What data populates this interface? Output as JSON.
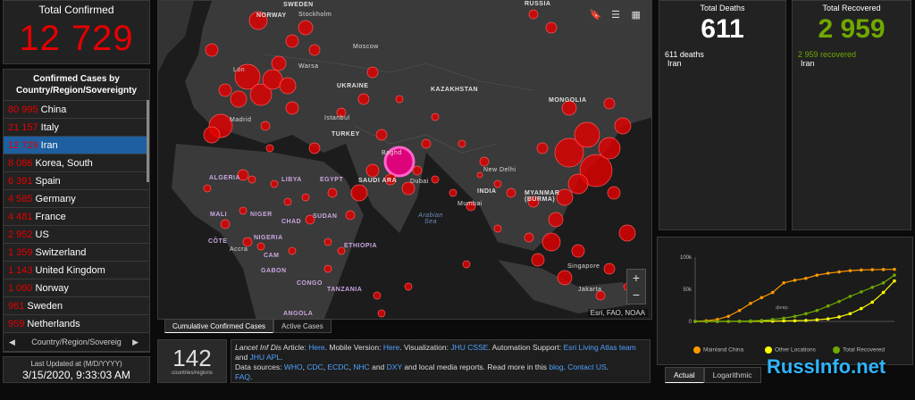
{
  "total_confirmed": {
    "title": "Total Confirmed",
    "value": "12 729"
  },
  "country_list": {
    "title": "Confirmed Cases by Country/Region/Sovereignty",
    "items": [
      {
        "count": "80 995",
        "name": "China"
      },
      {
        "count": "21 157",
        "name": "Italy"
      },
      {
        "count": "12 729",
        "name": "Iran"
      },
      {
        "count": "8 086",
        "name": "Korea, South"
      },
      {
        "count": "6 391",
        "name": "Spain"
      },
      {
        "count": "4 585",
        "name": "Germany"
      },
      {
        "count": "4 481",
        "name": "France"
      },
      {
        "count": "2 952",
        "name": "US"
      },
      {
        "count": "1 359",
        "name": "Switzerland"
      },
      {
        "count": "1 143",
        "name": "United Kingdom"
      },
      {
        "count": "1 090",
        "name": "Norway"
      },
      {
        "count": "961",
        "name": "Sweden"
      },
      {
        "count": "959",
        "name": "Netherlands"
      }
    ],
    "selected_index": 2,
    "tab_label": "Country/Region/Sovereig",
    "prev_arrow": "◀",
    "next_arrow": "▶"
  },
  "last_updated": {
    "label": "Last Updated at (M/D/YYYY)",
    "value": "3/15/2020, 9:33:03 AM"
  },
  "map": {
    "labels": {
      "russia": "RUSSIA",
      "norway": "NORWAY",
      "sweden": "SWEDEN",
      "stockholm": "Stockholm",
      "moscow": "Moscow",
      "ukraine": "UKRAINE",
      "kazakhstan": "KAZAKHSTAN",
      "mongolia": "MONGOLIA",
      "turkey": "TURKEY",
      "istanbul": "Istanbul",
      "baghdad": "Baghd",
      "dubai": "Dubai",
      "saudi": "SAUDI ARA",
      "new_delhi": "New Delhi",
      "india": "INDIA",
      "mumbai": "Mumbai",
      "myanmar": "MYANMAR (BURMA)",
      "singapore": "Singapore",
      "jakarta": "Jakarta",
      "algeria": "ALGERIA",
      "libya": "LIBYA",
      "egypt": "EGYPT",
      "mali": "MALI",
      "niger": "NIGER",
      "chad": "CHAD",
      "sudan": "SUDAN",
      "nigeria": "NIGERIA",
      "ethiopia": "ETHIOPIA",
      "accra": "Accra",
      "congo": "CONGO",
      "tanzania": "TANZANIA",
      "angola": "ANGOLA",
      "arabian_sea": "Arabian Sea",
      "madrid": "Madrid",
      "warsaw": "Warsa",
      "london": "Lon",
      "gabon": "GABON",
      "cameroon": "CAM",
      "cote": "CÔTE"
    },
    "toolbar": {
      "bookmark": "🔖",
      "list": "☰",
      "grid": "▦"
    },
    "zoom_in": "+",
    "zoom_out": "−",
    "attribution": "Esri, FAO, NOAA"
  },
  "map_tabs": [
    {
      "label": "Cumulative Confirmed Cases",
      "active": true
    },
    {
      "label": "Active Cases",
      "active": false
    }
  ],
  "countries_count": {
    "value": "142",
    "label": "countries/regions"
  },
  "info_text": {
    "line1_prefix": "Lancet Inf Dis",
    "line1_mid": " Article: ",
    "here1": "Here",
    "mobile": ". Mobile Version: ",
    "here2": "Here",
    "viz": ". Visualization: ",
    "jhu_csse": "JHU CSSE",
    "auto": ". Automation Support: ",
    "esri": "Esri Living Atlas team",
    "and": " and ",
    "jhu_apl": "JHU APL",
    "dot": ".",
    "sources": "Data sources: ",
    "who": "WHO",
    "cdc": "CDC",
    "ecdc": "ECDC",
    "nhc": "NHC",
    "dxy": "DXY",
    "sources_tail": " and local media reports. Read more in this ",
    "blog": "blog",
    "contact": "Contact US",
    "faq": "FAQ"
  },
  "deaths": {
    "title": "Total Deaths",
    "value": "611",
    "detail_value": "611 deaths",
    "detail_place": "Iran"
  },
  "recovered": {
    "title": "Total Recovered",
    "value": "2 959",
    "detail_value": "2 959 recovered",
    "detail_place": "Iran"
  },
  "chart_data": {
    "type": "line",
    "ylim": [
      0,
      100000
    ],
    "yticks": [
      "100k",
      "50k",
      "0"
    ],
    "xlabel_tick": "февр.",
    "series": [
      {
        "name": "Mainland China",
        "color": "#ff9900",
        "values": [
          0,
          1000,
          3000,
          8000,
          17000,
          28000,
          37000,
          45000,
          60000,
          64000,
          67000,
          72000,
          75000,
          77000,
          79000,
          80000,
          80500,
          80800,
          81000
        ]
      },
      {
        "name": "Other Locations",
        "color": "#ffff00",
        "values": [
          0,
          0,
          0,
          0,
          100,
          200,
          300,
          500,
          800,
          1000,
          1500,
          2500,
          4000,
          7000,
          12000,
          20000,
          30000,
          45000,
          63000
        ]
      },
      {
        "name": "Total Recovered",
        "color": "#70a800",
        "values": [
          0,
          0,
          0,
          100,
          300,
          800,
          1500,
          3000,
          5000,
          8000,
          12000,
          17000,
          24000,
          31000,
          39000,
          46000,
          53000,
          60000,
          72000
        ]
      }
    ]
  },
  "chart_tabs": [
    {
      "label": "Actual",
      "active": true
    },
    {
      "label": "Logarithmic",
      "active": false
    }
  ],
  "watermark": "RussInfo.net",
  "colors": {
    "accent_red": "#e60000",
    "recovered_green": "#70a800",
    "bubble": "#e60000",
    "highlight": "#e6007e"
  }
}
